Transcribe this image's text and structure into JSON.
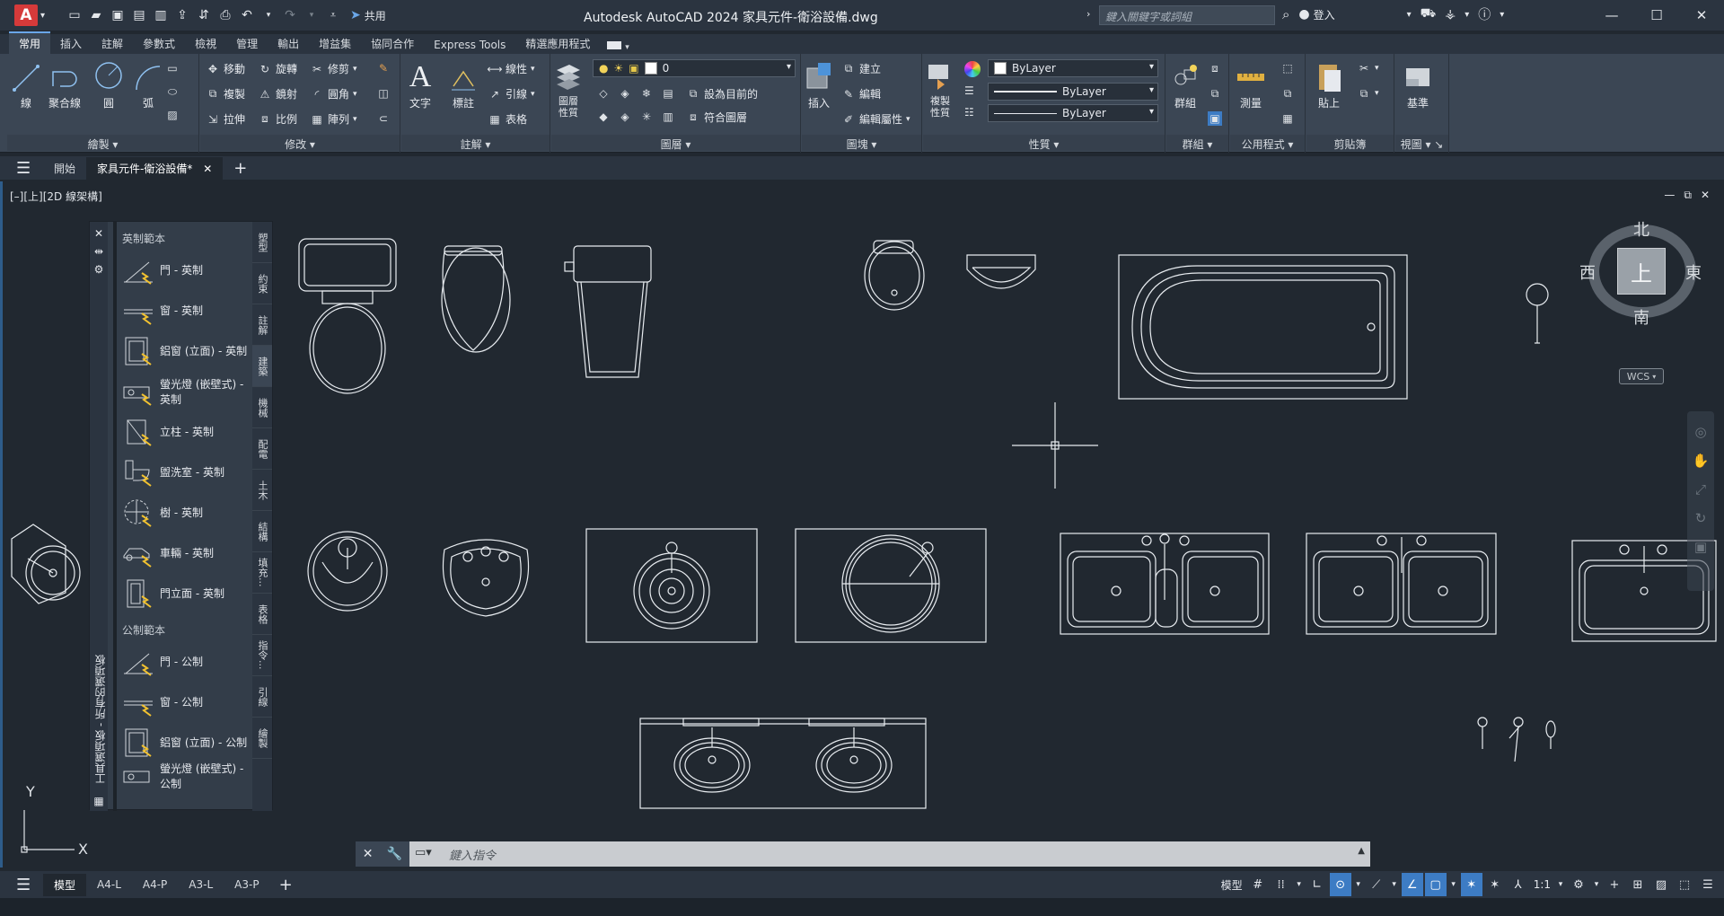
{
  "app": {
    "logo": "A",
    "title": "Autodesk AutoCAD 2024    家具元件-衛浴設備.dwg",
    "share_label": "共用",
    "search_placeholder": "鍵入關鍵字或詞組",
    "signin_label": "登入"
  },
  "ribbon": {
    "tabs": [
      "常用",
      "插入",
      "註解",
      "參數式",
      "檢視",
      "管理",
      "輸出",
      "增益集",
      "協同合作",
      "Express Tools",
      "精選應用程式"
    ],
    "draw": {
      "title": "繪製",
      "line": "線",
      "polyline": "聚合線",
      "circle": "圓",
      "arc": "弧"
    },
    "modify": {
      "title": "修改",
      "move": "移動",
      "rotate": "旋轉",
      "trim": "修剪",
      "copy": "複製",
      "mirror": "鏡射",
      "fillet": "圓角",
      "stretch": "拉伸",
      "scale": "比例",
      "array": "陣列"
    },
    "annotation": {
      "title": "註解",
      "text": "文字",
      "dimension": "標註",
      "linear": "線性",
      "leader": "引線",
      "table": "表格"
    },
    "layers": {
      "title": "圖層",
      "props": "圖層\n性質",
      "current_layer": "0",
      "make_current": "設為目前的",
      "match_layer": "符合圖層"
    },
    "block": {
      "title": "圖塊",
      "insert": "插入",
      "create": "建立",
      "edit": "編輯",
      "edit_attr": "編輯屬性"
    },
    "properties": {
      "title": "性質",
      "match": "複製\n性質",
      "color": "ByLayer",
      "linetype": "ByLayer",
      "lineweight": "ByLayer"
    },
    "groups": {
      "title": "群組",
      "group": "群組"
    },
    "utilities": {
      "title": "公用程式",
      "measure": "測量"
    },
    "clipboard": {
      "title": "剪貼簿",
      "paste": "貼上"
    },
    "view": {
      "title": "視圖",
      "base": "基準"
    }
  },
  "doc_tabs": [
    "開始",
    "家具元件-衛浴設備*"
  ],
  "viewport_label": "[–][上][2D 線架構]",
  "palette": {
    "vertical_title": "工具選項板 - 所有的選項板",
    "section_imperial": "英制範本",
    "section_metric": "公制範本",
    "items_imperial": [
      "門 - 英制",
      "窗 - 英制",
      "鋁窗 (立面) - 英制",
      "螢光燈 (嵌壁式) - 英制",
      "立柱 - 英制",
      "盥洗室 - 英制",
      "樹 - 英制",
      "車輛 - 英制",
      "門立面 - 英制"
    ],
    "items_metric": [
      "門 - 公制",
      "窗 - 公制",
      "鋁窗 (立面) - 公制",
      "螢光燈 (嵌壁式) - 公制"
    ],
    "tabs": [
      "塑型",
      "約束",
      "註解",
      "建築",
      "機械",
      "配電",
      "土木",
      "結構",
      "填充...",
      "表格",
      "指令...",
      "引線",
      "繪製"
    ],
    "active_tab": "建築"
  },
  "viewcube": {
    "top": "上",
    "north": "北",
    "south": "南",
    "east": "東",
    "west": "西",
    "wcs": "WCS"
  },
  "ucs": {
    "x": "X",
    "y": "Y"
  },
  "command": {
    "placeholder": "鍵入指令"
  },
  "layout_tabs": [
    "模型",
    "A4-L",
    "A4-P",
    "A3-L",
    "A3-P"
  ],
  "status": {
    "model": "模型",
    "scale": "1:1"
  },
  "colors": {
    "background": "#212830",
    "ribbon": "#3b4654",
    "accent": "#3d7cc4",
    "command_line": "#c9ccd0"
  }
}
